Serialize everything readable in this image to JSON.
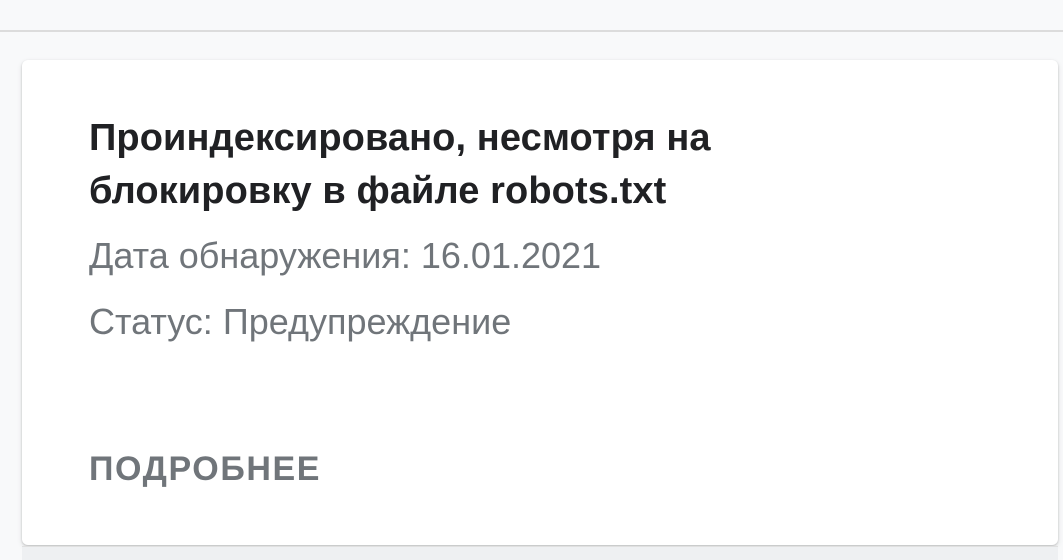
{
  "issue": {
    "title": "Проиндексировано, несмотря на блокировку в файле robots.txt",
    "detection_date_label": "Дата обнаружения:",
    "detection_date": "16.01.2021",
    "status_label": "Статус:",
    "status_value": "Предупреждение",
    "details_button_label": "ПОДРОБНЕЕ"
  },
  "colors": {
    "title": "#202124",
    "secondary_text": "#70757a",
    "card_background": "#ffffff",
    "page_background": "#f8f9fa"
  }
}
